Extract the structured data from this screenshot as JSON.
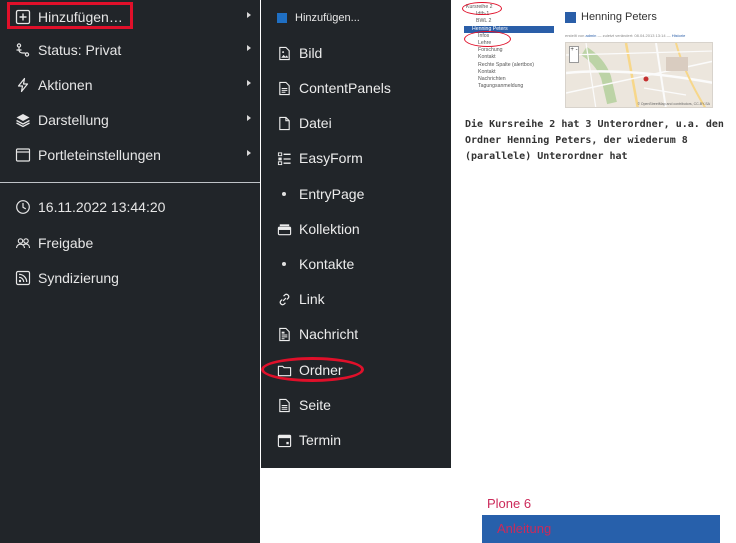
{
  "toolbar": {
    "items": [
      {
        "label": "Hinzufügen…",
        "icon": "plus-square-icon"
      },
      {
        "label": "Status: Privat",
        "icon": "status-icon"
      },
      {
        "label": "Aktionen",
        "icon": "lightning-icon"
      },
      {
        "label": "Darstellung",
        "icon": "layers-icon"
      },
      {
        "label": "Portleteinstellungen",
        "icon": "window-icon"
      }
    ],
    "bottom_items": [
      {
        "label": "16.11.2022 13:44:20",
        "icon": "clock-icon"
      },
      {
        "label": "Freigabe",
        "icon": "people-icon"
      },
      {
        "label": "Syndizierung",
        "icon": "rss-icon"
      }
    ]
  },
  "submenu": {
    "header": "Hinzufügen...",
    "items": [
      {
        "label": "Bild",
        "icon": "image-file-icon"
      },
      {
        "label": "ContentPanels",
        "icon": "text-file-icon"
      },
      {
        "label": "Datei",
        "icon": "file-icon"
      },
      {
        "label": "EasyForm",
        "icon": "form-list-icon"
      },
      {
        "label": "EntryPage",
        "icon": "bullet-icon"
      },
      {
        "label": "Kollektion",
        "icon": "collection-icon"
      },
      {
        "label": "Kontakte",
        "icon": "bullet-icon"
      },
      {
        "label": "Link",
        "icon": "link-icon"
      },
      {
        "label": "Nachricht",
        "icon": "news-file-icon"
      },
      {
        "label": "Ordner",
        "icon": "folder-icon"
      },
      {
        "label": "Seite",
        "icon": "page-icon"
      },
      {
        "label": "Termin",
        "icon": "calendar-icon"
      }
    ]
  },
  "thumbnail": {
    "nav": [
      "Kursreihe 2",
      "Idth-1",
      "BWL 2",
      "Henning Peters",
      "Infos",
      "Lehre",
      "Forschung",
      "Kontakt",
      "Rechte Spalte (alertbox)",
      "Kontakt",
      "Nachrichten",
      "Tagungsanmeldung"
    ],
    "title": "Henning Peters",
    "meta_prefix": "erstellt von",
    "meta_author": "admin",
    "meta_suffix": "— zuletzt verändert: 08.04.2013 13:14 —",
    "meta_link": "Historie",
    "map_zoom": "+ -",
    "map_footer": "© OpenStreetMap and contributors, CC-BY-SA"
  },
  "caption": "Die Kursreihe 2 hat 3 Unterordner, u.a. den Ordner Henning Peters, der wiederum 8 (parallele) Unterordner hat",
  "footer": {
    "plone_label": "Plone 6",
    "anleitung_label": "Anleitung"
  },
  "colors": {
    "toolbar_bg": "#212529",
    "highlight_red": "#e0102a",
    "accent_blue": "#2760ab",
    "footer_text": "#cc2a5a"
  }
}
